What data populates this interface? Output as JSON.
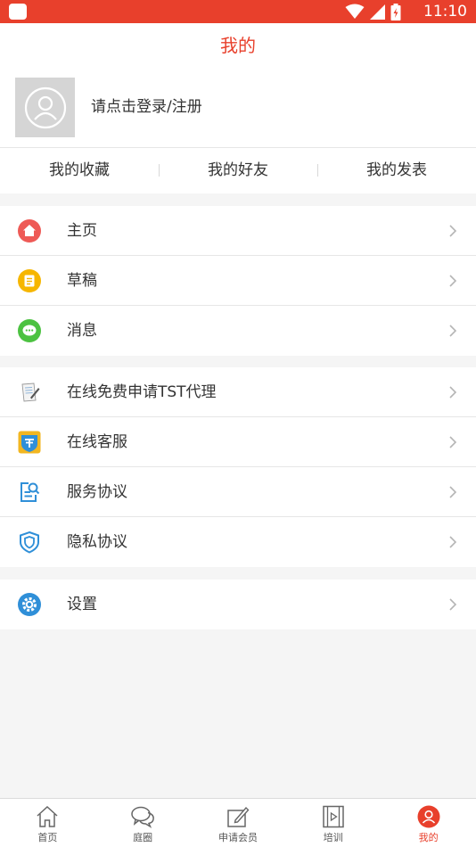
{
  "status_bar": {
    "time": "11:10",
    "icons": [
      "app-icon",
      "wifi-icon",
      "signal-icon",
      "battery-icon"
    ],
    "background": "#e8402c"
  },
  "header": {
    "title": "我的"
  },
  "profile": {
    "login_prompt": "请点击登录/注册",
    "avatar_icon": "user-icon"
  },
  "quick_links": [
    {
      "label": "我的收藏"
    },
    {
      "label": "我的好友"
    },
    {
      "label": "我的发表"
    }
  ],
  "menu_groups": [
    [
      {
        "label": "主页",
        "icon": "home-icon"
      },
      {
        "label": "草稿",
        "icon": "draft-icon"
      },
      {
        "label": "消息",
        "icon": "message-icon"
      }
    ],
    [
      {
        "label": "在线免费申请TST代理",
        "icon": "notepad-icon"
      },
      {
        "label": "在线客服",
        "icon": "customer-service-icon"
      },
      {
        "label": "服务协议",
        "icon": "service-agreement-icon"
      },
      {
        "label": "隐私协议",
        "icon": "shield-icon"
      }
    ],
    [
      {
        "label": "设置",
        "icon": "settings-icon"
      }
    ]
  ],
  "tabbar": {
    "items": [
      {
        "label": "首页",
        "icon": "home-outline-icon",
        "active": false
      },
      {
        "label": "庭圈",
        "icon": "chat-bubbles-icon",
        "active": false
      },
      {
        "label": "申请会员",
        "icon": "edit-icon",
        "active": false
      },
      {
        "label": "培训",
        "icon": "video-icon",
        "active": false
      },
      {
        "label": "我的",
        "icon": "user-circle-icon",
        "active": true
      }
    ]
  },
  "colors": {
    "accent": "#e8402c",
    "page_background": "#f5f5f5",
    "divider": "#e6e6e6"
  }
}
